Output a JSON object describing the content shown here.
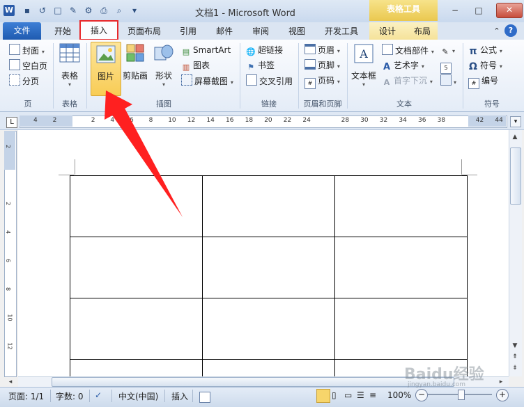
{
  "window": {
    "title": "文档1 - Microsoft Word",
    "context_header": "表格工具",
    "minimize": "−",
    "maximize": "□",
    "close": "✕"
  },
  "quick_access": [
    "W",
    "💾",
    "↺",
    "□",
    "✎",
    "⚙",
    "🖨",
    "🔍",
    "▾"
  ],
  "tabs": [
    {
      "id": "file",
      "label": "文件"
    },
    {
      "id": "home",
      "label": "开始"
    },
    {
      "id": "insert",
      "label": "插入"
    },
    {
      "id": "page_layout",
      "label": "页面布局"
    },
    {
      "id": "references",
      "label": "引用"
    },
    {
      "id": "mailings",
      "label": "邮件"
    },
    {
      "id": "review",
      "label": "审阅"
    },
    {
      "id": "view",
      "label": "视图"
    },
    {
      "id": "developer",
      "label": "开发工具"
    },
    {
      "id": "design",
      "label": "设计"
    },
    {
      "id": "layout",
      "label": "布局"
    }
  ],
  "ribbon": {
    "pages": {
      "items": [
        "封面",
        "空白页",
        "分页"
      ],
      "label": "页"
    },
    "tables": {
      "button": "表格",
      "label": "表格"
    },
    "illustrations": {
      "picture": "图片",
      "clipart": "剪贴画",
      "shapes": "形状",
      "smartart": "SmartArt",
      "chart": "图表",
      "screenshot": "屏幕截图",
      "label": "插图"
    },
    "links": {
      "items": [
        "超链接",
        "书签",
        "交叉引用"
      ],
      "label": "链接"
    },
    "header_footer": {
      "items": [
        "页眉",
        "页脚",
        "页码"
      ],
      "label": "页眉和页脚"
    },
    "text": {
      "textbox": "文本框",
      "items": [
        "文档部件",
        "艺术字",
        "首字下沉"
      ],
      "label": "文本"
    },
    "symbols": {
      "items": [
        "公式",
        "符号",
        "编号"
      ],
      "label": "符号"
    }
  },
  "ruler": {
    "h_labels": [
      "4",
      "2",
      "",
      "2",
      "4",
      "6",
      "8",
      "10",
      "12",
      "14",
      "16",
      "18",
      "20",
      "22",
      "24",
      "",
      "28",
      "30",
      "32",
      "34",
      "36",
      "38",
      "",
      "42",
      "44"
    ],
    "v_labels": [
      "2",
      "",
      "2",
      "4",
      "6",
      "8",
      "10",
      "12"
    ]
  },
  "status": {
    "page": "页面: 1/1",
    "words": "字数: 0",
    "language": "中文(中国)",
    "mode": "插入",
    "zoom": "100%",
    "zoom_minus": "−",
    "zoom_plus": "+"
  },
  "table": {
    "rows": 4,
    "cols": 3
  },
  "watermark": {
    "main": "Baidu经验",
    "sub": "jingyan.baidu.com"
  },
  "colors": {
    "highlight_box": "#e8272a",
    "arrow": "#ff2020",
    "file_tab": "#2b67bf",
    "context": "#f1cf5a"
  }
}
